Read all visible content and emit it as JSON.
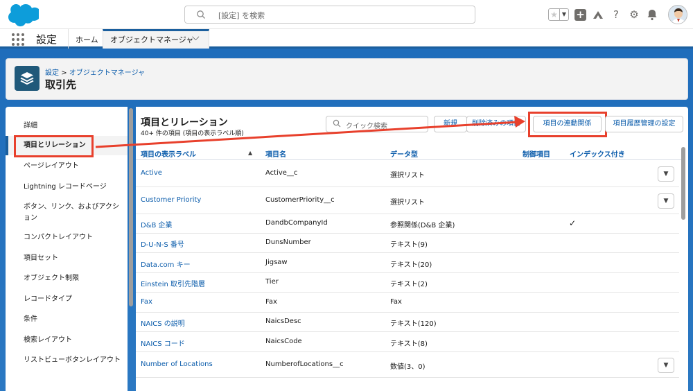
{
  "search": {
    "placeholder": "[設定] を検索"
  },
  "nav": {
    "app_name": "設定",
    "home": "ホーム",
    "active_tab": "オブジェクトマネージャ"
  },
  "header": {
    "crumb_root": "設定",
    "crumb_sep": ">",
    "crumb_child": "オブジェクトマネージャ",
    "title": "取引先"
  },
  "sidebar": {
    "items": [
      {
        "label": "詳細"
      },
      {
        "label": "項目とリレーション"
      },
      {
        "label": "ページレイアウト"
      },
      {
        "label": "Lightning レコードページ"
      },
      {
        "label": "ボタン、リンク、およびアクション"
      },
      {
        "label": "コンパクトレイアウト"
      },
      {
        "label": "項目セット"
      },
      {
        "label": "オブジェクト制限"
      },
      {
        "label": "レコードタイプ"
      },
      {
        "label": "条件"
      },
      {
        "label": "検索レイアウト"
      },
      {
        "label": "リストビューボタンレイアウト"
      }
    ]
  },
  "main": {
    "title": "項目とリレーション",
    "subtitle": "40+ 件の項目 (項目の表示ラベル順)",
    "quick_search_placeholder": "クイック検索",
    "buttons": {
      "new": "新規",
      "deleted": "削除済みの項目",
      "dependencies": "項目の連動関係",
      "history": "項目履歴管理の設定"
    },
    "columns": [
      "項目の表示ラベル",
      "項目名",
      "データ型",
      "制御項目",
      "インデックス付き"
    ],
    "sort_indicator": "▲",
    "rows": [
      {
        "label": "Active",
        "api": "Active__c",
        "type": "選択リスト",
        "controlling": "",
        "indexed": false,
        "action": true
      },
      {
        "label": "Customer Priority",
        "api": "CustomerPriority__c",
        "type": "選択リスト",
        "controlling": "",
        "indexed": false,
        "action": true
      },
      {
        "label": "D&B 企業",
        "api": "DandbCompanyId",
        "type": "参照関係(D&B 企業)",
        "controlling": "",
        "indexed": true,
        "action": false
      },
      {
        "label": "D-U-N-S 番号",
        "api": "DunsNumber",
        "type": "テキスト(9)",
        "controlling": "",
        "indexed": false,
        "action": false
      },
      {
        "label": "Data.com キー",
        "api": "Jigsaw",
        "type": "テキスト(20)",
        "controlling": "",
        "indexed": false,
        "action": false
      },
      {
        "label": "Einstein 取引先階層",
        "api": "Tier",
        "type": "テキスト(2)",
        "controlling": "",
        "indexed": false,
        "action": false
      },
      {
        "label": "Fax",
        "api": "Fax",
        "type": "Fax",
        "controlling": "",
        "indexed": false,
        "action": false
      },
      {
        "label": "NAICS の説明",
        "api": "NaicsDesc",
        "type": "テキスト(120)",
        "controlling": "",
        "indexed": false,
        "action": false
      },
      {
        "label": "NAICS コード",
        "api": "NaicsCode",
        "type": "テキスト(8)",
        "controlling": "",
        "indexed": false,
        "action": false
      },
      {
        "label": "Number of Locations",
        "api": "NumberofLocations__c",
        "type": "数値(3、0)",
        "controlling": "",
        "indexed": false,
        "action": true
      }
    ]
  },
  "colors": {
    "accent": "#0b5cab",
    "brand_blue": "#1b5f9e",
    "highlight_red": "#e8402c"
  }
}
